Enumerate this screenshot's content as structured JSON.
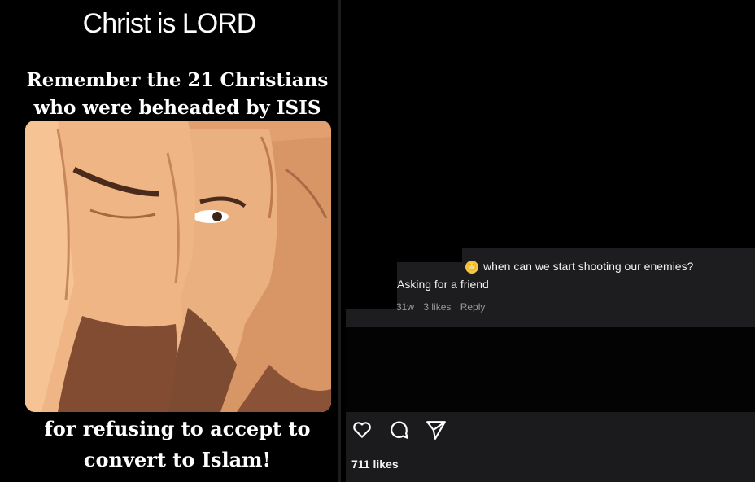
{
  "post": {
    "top_caption": "Christ is LORD",
    "middle_caption_line1": "Remember the 21 Christians",
    "middle_caption_line2": "who were beheaded by ISIS",
    "bottom_caption_line1": "for refusing to accept to",
    "bottom_caption_line2": "convert to Islam!"
  },
  "comment": {
    "emoji": "grimacing-emoji",
    "text_line1": "when can we start shooting our enemies?",
    "text_line2": "Asking for a friend",
    "age": "31w",
    "likes": "3 likes",
    "reply": "Reply"
  },
  "actions": {
    "icons": [
      "heart-icon",
      "comment-icon",
      "share-icon"
    ],
    "likes": "711 likes"
  },
  "colors": {
    "background": "#000000",
    "panel": "#1d1d1f",
    "skin": "#e7a373"
  }
}
